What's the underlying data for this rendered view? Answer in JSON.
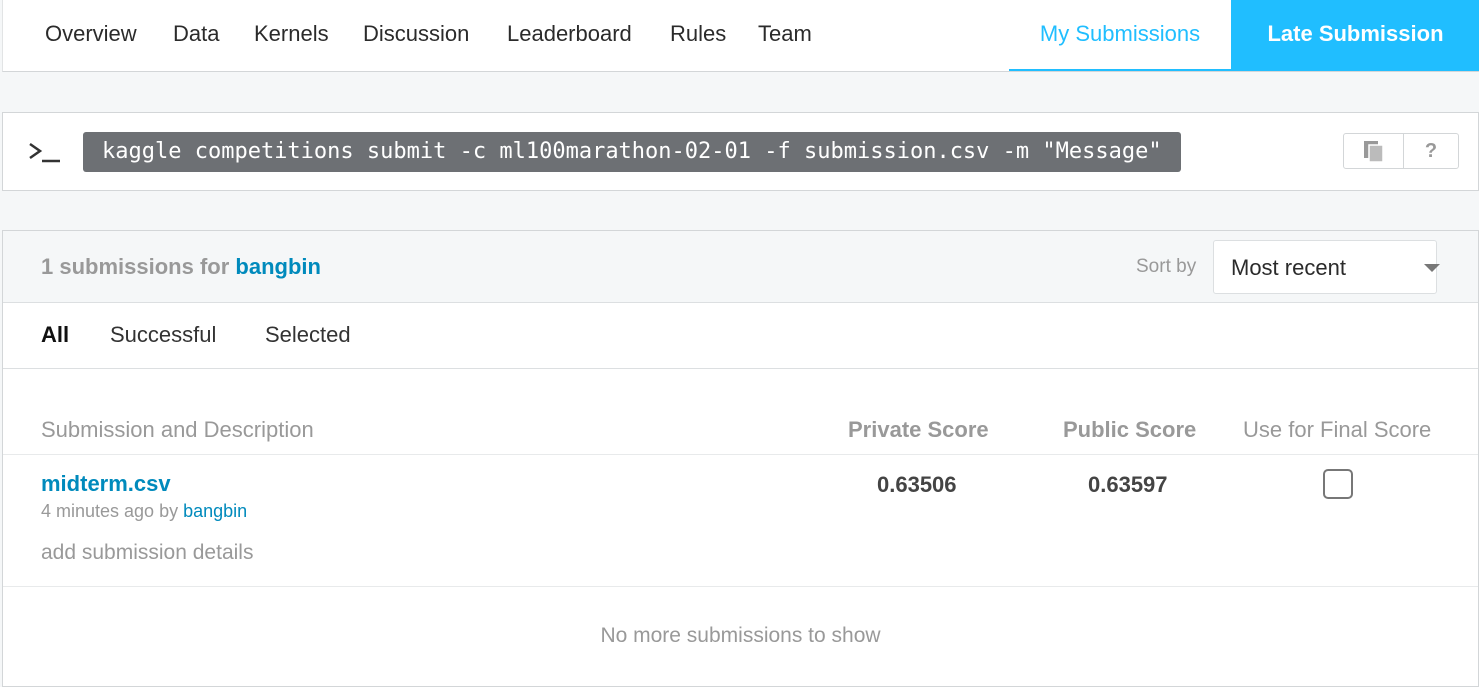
{
  "nav": {
    "tabs": [
      "Overview",
      "Data",
      "Kernels",
      "Discussion",
      "Leaderboard",
      "Rules",
      "Team"
    ],
    "my_submissions": "My Submissions",
    "late_submission": "Late Submission"
  },
  "cli": {
    "prompt_icon": "terminal-icon",
    "command": "kaggle competitions submit -c ml100marathon-02-01 -f submission.csv -m \"Message\"",
    "copy_icon": "copy-icon",
    "help_label": "?"
  },
  "submissions": {
    "count_text": "1 submissions for",
    "user": "bangbin",
    "sort_label": "Sort by",
    "sort_value": "Most recent",
    "filters": [
      "All",
      "Successful",
      "Selected"
    ],
    "active_filter": "All",
    "columns": {
      "description": "Submission and Description",
      "private": "Private Score",
      "public": "Public Score",
      "final": "Use for Final Score"
    },
    "rows": [
      {
        "file": "midterm.csv",
        "time": "4 minutes ago by",
        "user": "bangbin",
        "details_link": "add submission details",
        "private_score": "0.63506",
        "public_score": "0.63597",
        "use_for_final": false
      }
    ],
    "footer": "No more submissions to show"
  },
  "colors": {
    "accent": "#20beff",
    "link": "#008abc",
    "muted": "#999999"
  }
}
